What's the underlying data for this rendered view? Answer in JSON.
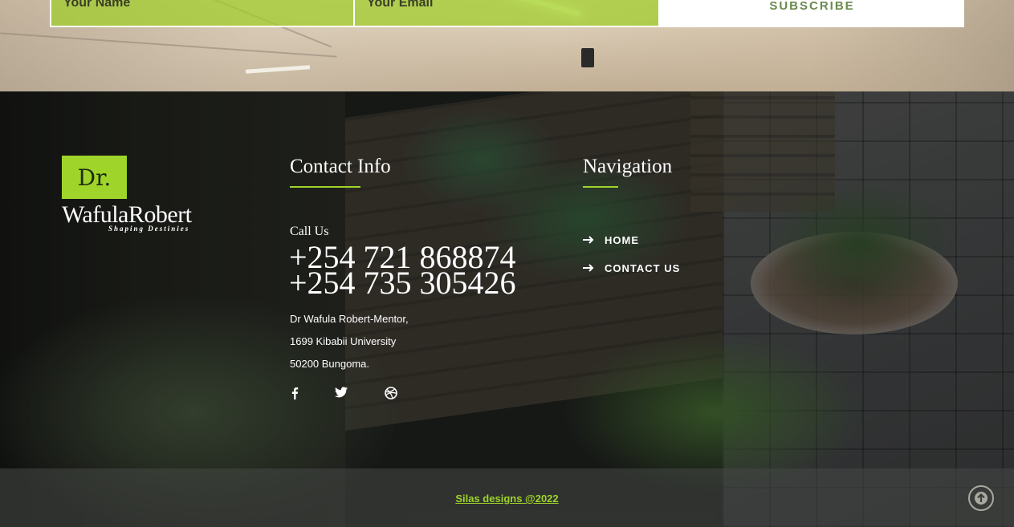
{
  "newsletter": {
    "name_placeholder": "Your Name",
    "email_placeholder": "Your Email",
    "subscribe_label": "SUBSCRIBE"
  },
  "logo": {
    "prefix": "Dr.",
    "name": "WafulaRobert",
    "tagline": "Shaping Destinies"
  },
  "contact": {
    "title": "Contact Info",
    "call_label": "Call Us",
    "phones": [
      "+254 721 868874",
      "+254 735 305426"
    ],
    "address_lines": [
      "Dr Wafula Robert-Mentor,",
      "1699 Kibabii University",
      "50200 Bungoma."
    ],
    "social_icons": [
      "facebook-icon",
      "twitter-icon",
      "dribbble-icon"
    ]
  },
  "navigation": {
    "title": "Navigation",
    "items": [
      {
        "label": "HOME",
        "icon": "arrow-right-icon"
      },
      {
        "label": "CONTACT US",
        "icon": "arrow-right-icon"
      }
    ]
  },
  "footer": {
    "copyright": "Silas designs @2022",
    "back_to_top_icon": "arrow-up-circle-icon"
  },
  "colors": {
    "accent": "#9fd42a",
    "text": "#ffffff"
  }
}
